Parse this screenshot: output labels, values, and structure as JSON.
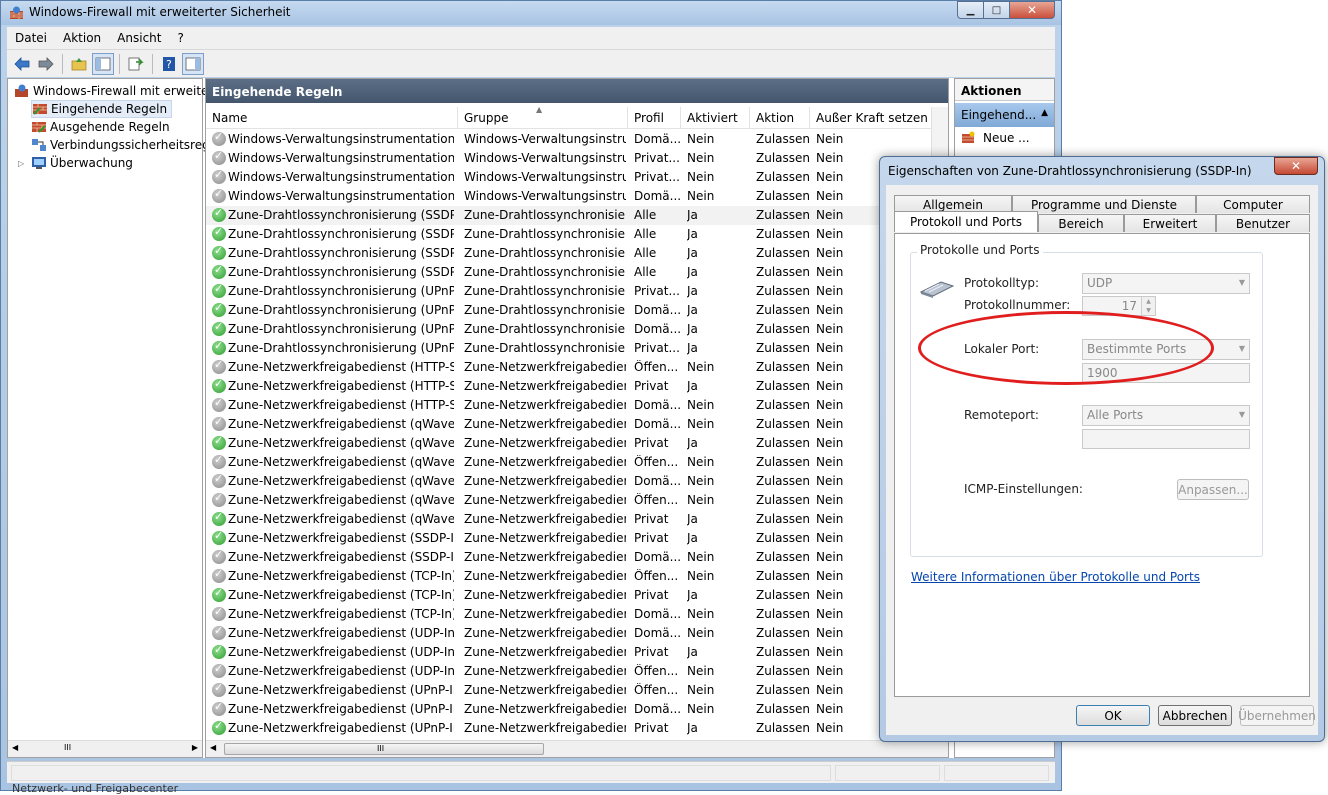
{
  "window": {
    "title": "Windows-Firewall mit erweiterter Sicherheit",
    "min": "▁",
    "max": "□",
    "close": "✕"
  },
  "menu": [
    "Datei",
    "Aktion",
    "Ansicht",
    "?"
  ],
  "tree": {
    "root": "Windows-Firewall mit erweitert",
    "items": [
      "Eingehende Regeln",
      "Ausgehende Regeln",
      "Verbindungssicherheitsrege",
      "Überwachung"
    ]
  },
  "center": {
    "header": "Eingehende Regeln",
    "columns": [
      "Name",
      "Gruppe",
      "Profil",
      "Aktiviert",
      "Aktion",
      "Außer Kraft setzen"
    ],
    "rows": [
      [
        "Windows-Verwaltungsinstrumentation (...",
        "Windows-Verwaltungsinstru...",
        "Domä...",
        "Nein",
        "Zulassen",
        "Nein"
      ],
      [
        "Windows-Verwaltungsinstrumentation (...",
        "Windows-Verwaltungsinstru...",
        "Privat...",
        "Nein",
        "Zulassen",
        "Nein"
      ],
      [
        "Windows-Verwaltungsinstrumentation (...",
        "Windows-Verwaltungsinstru...",
        "Privat...",
        "Nein",
        "Zulassen",
        "Nein"
      ],
      [
        "Windows-Verwaltungsinstrumentation (...",
        "Windows-Verwaltungsinstru...",
        "Domä...",
        "Nein",
        "Zulassen",
        "Nein"
      ],
      [
        "Zune-Drahtlossynchronisierung (SSDP-In)",
        "Zune-Drahtlossynchronisier...",
        "Alle",
        "Ja",
        "Zulassen",
        "Nein"
      ],
      [
        "Zune-Drahtlossynchronisierung (SSDP-In)",
        "Zune-Drahtlossynchronisier...",
        "Alle",
        "Ja",
        "Zulassen",
        "Nein"
      ],
      [
        "Zune-Drahtlossynchronisierung (SSDP-In)",
        "Zune-Drahtlossynchronisier...",
        "Alle",
        "Ja",
        "Zulassen",
        "Nein"
      ],
      [
        "Zune-Drahtlossynchronisierung (SSDP-In)",
        "Zune-Drahtlossynchronisier...",
        "Alle",
        "Ja",
        "Zulassen",
        "Nein"
      ],
      [
        "Zune-Drahtlossynchronisierung (UPnP-In)",
        "Zune-Drahtlossynchronisier...",
        "Privat...",
        "Ja",
        "Zulassen",
        "Nein"
      ],
      [
        "Zune-Drahtlossynchronisierung (UPnP-In)",
        "Zune-Drahtlossynchronisier...",
        "Domä...",
        "Ja",
        "Zulassen",
        "Nein"
      ],
      [
        "Zune-Drahtlossynchronisierung (UPnP-In)",
        "Zune-Drahtlossynchronisier...",
        "Domä...",
        "Ja",
        "Zulassen",
        "Nein"
      ],
      [
        "Zune-Drahtlossynchronisierung (UPnP-In)",
        "Zune-Drahtlossynchronisier...",
        "Privat...",
        "Ja",
        "Zulassen",
        "Nein"
      ],
      [
        "Zune-Netzwerkfreigabedienst (HTTP-Str...",
        "Zune-Netzwerkfreigabedienst",
        "Öffen...",
        "Nein",
        "Zulassen",
        "Nein"
      ],
      [
        "Zune-Netzwerkfreigabedienst (HTTP-Str...",
        "Zune-Netzwerkfreigabedienst",
        "Privat",
        "Ja",
        "Zulassen",
        "Nein"
      ],
      [
        "Zune-Netzwerkfreigabedienst (HTTP-Str...",
        "Zune-Netzwerkfreigabedienst",
        "Domä...",
        "Nein",
        "Zulassen",
        "Nein"
      ],
      [
        "Zune-Netzwerkfreigabedienst (qWave-T...",
        "Zune-Netzwerkfreigabedienst",
        "Domä...",
        "Nein",
        "Zulassen",
        "Nein"
      ],
      [
        "Zune-Netzwerkfreigabedienst (qWave-T...",
        "Zune-Netzwerkfreigabedienst",
        "Privat",
        "Ja",
        "Zulassen",
        "Nein"
      ],
      [
        "Zune-Netzwerkfreigabedienst (qWave-T...",
        "Zune-Netzwerkfreigabedienst",
        "Öffen...",
        "Nein",
        "Zulassen",
        "Nein"
      ],
      [
        "Zune-Netzwerkfreigabedienst (qWave-U...",
        "Zune-Netzwerkfreigabedienst",
        "Domä...",
        "Nein",
        "Zulassen",
        "Nein"
      ],
      [
        "Zune-Netzwerkfreigabedienst (qWave-U...",
        "Zune-Netzwerkfreigabedienst",
        "Öffen...",
        "Nein",
        "Zulassen",
        "Nein"
      ],
      [
        "Zune-Netzwerkfreigabedienst (qWave-U...",
        "Zune-Netzwerkfreigabedienst",
        "Privat",
        "Ja",
        "Zulassen",
        "Nein"
      ],
      [
        "Zune-Netzwerkfreigabedienst (SSDP-In)",
        "Zune-Netzwerkfreigabedienst",
        "Privat",
        "Ja",
        "Zulassen",
        "Nein"
      ],
      [
        "Zune-Netzwerkfreigabedienst (SSDP-In)",
        "Zune-Netzwerkfreigabedienst",
        "Domä...",
        "Nein",
        "Zulassen",
        "Nein"
      ],
      [
        "Zune-Netzwerkfreigabedienst (TCP-In)",
        "Zune-Netzwerkfreigabedienst",
        "Öffen...",
        "Nein",
        "Zulassen",
        "Nein"
      ],
      [
        "Zune-Netzwerkfreigabedienst (TCP-In)",
        "Zune-Netzwerkfreigabedienst",
        "Privat",
        "Ja",
        "Zulassen",
        "Nein"
      ],
      [
        "Zune-Netzwerkfreigabedienst (TCP-In)",
        "Zune-Netzwerkfreigabedienst",
        "Domä...",
        "Nein",
        "Zulassen",
        "Nein"
      ],
      [
        "Zune-Netzwerkfreigabedienst (UDP-In)",
        "Zune-Netzwerkfreigabedienst",
        "Domä...",
        "Nein",
        "Zulassen",
        "Nein"
      ],
      [
        "Zune-Netzwerkfreigabedienst (UDP-In)",
        "Zune-Netzwerkfreigabedienst",
        "Privat",
        "Ja",
        "Zulassen",
        "Nein"
      ],
      [
        "Zune-Netzwerkfreigabedienst (UDP-In)",
        "Zune-Netzwerkfreigabedienst",
        "Öffen...",
        "Nein",
        "Zulassen",
        "Nein"
      ],
      [
        "Zune-Netzwerkfreigabedienst (UPnP-In)",
        "Zune-Netzwerkfreigabedienst",
        "Öffen...",
        "Nein",
        "Zulassen",
        "Nein"
      ],
      [
        "Zune-Netzwerkfreigabedienst (UPnP-In)",
        "Zune-Netzwerkfreigabedienst",
        "Domä...",
        "Nein",
        "Zulassen",
        "Nein"
      ],
      [
        "Zune-Netzwerkfreigabedienst (UPnP-In)",
        "Zune-Netzwerkfreigabedienst",
        "Privat",
        "Ja",
        "Zulassen",
        "Nein"
      ]
    ],
    "scroll_grip": "III"
  },
  "actions": {
    "title": "Aktionen",
    "section": "Eingehend...",
    "new": "Neue ..."
  },
  "dialog": {
    "title": "Eigenschaften von Zune-Drahtlossynchronisierung (SSDP-In)",
    "tabs_top": [
      "Allgemein",
      "Programme und Dienste",
      "Computer"
    ],
    "tabs_bottom": [
      "Protokoll und Ports",
      "Bereich",
      "Erweitert",
      "Benutzer"
    ],
    "group": "Protokolle und Ports",
    "protocol_type_label": "Protokolltyp:",
    "protocol_type_value": "UDP",
    "protocol_number_label": "Protokollnummer:",
    "protocol_number_value": "17",
    "local_port_label": "Lokaler Port:",
    "local_port_value": "Bestimmte Ports",
    "local_port_number": "1900",
    "remote_port_label": "Remoteport:",
    "remote_port_value": "Alle Ports",
    "icmp_label": "ICMP-Einstellungen:",
    "customize": "Anpassen...",
    "link": "Weitere Informationen über Protokolle und Ports",
    "ok": "OK",
    "cancel": "Abbrechen",
    "apply": "Übernehmen"
  },
  "taskbar": {
    "text": "Netzwerk- und Freigabecenter"
  },
  "colors": {
    "annotation": "#e01e1e",
    "header_bg": "#4d5f76",
    "enabled_icon": "#2f9b2f",
    "disabled_icon": "#8a8a8a"
  }
}
